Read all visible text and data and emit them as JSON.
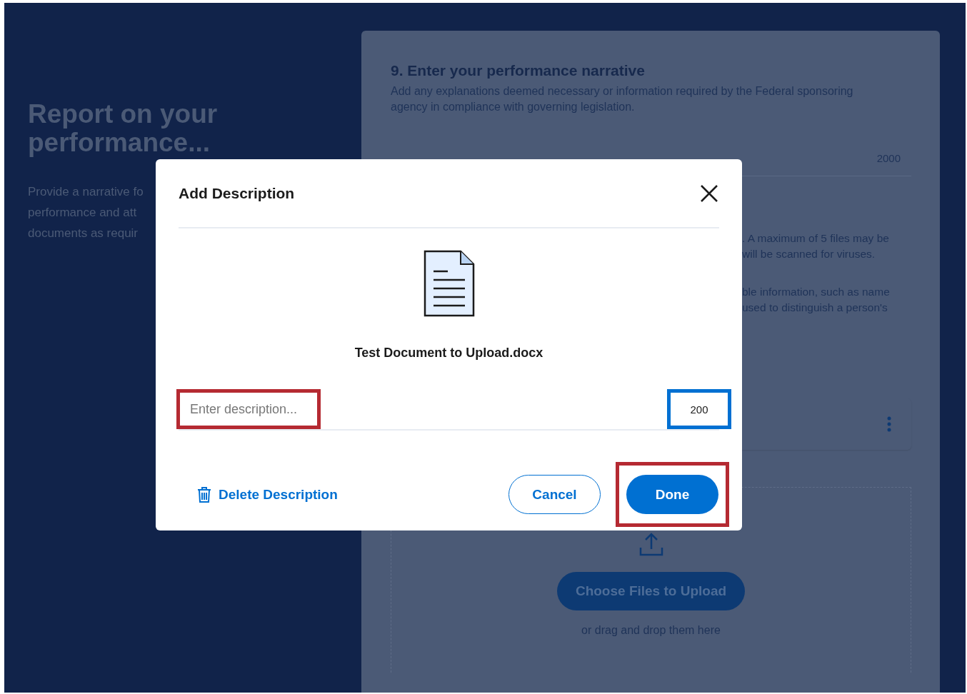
{
  "intro": {
    "title": "Report on your performance...",
    "lines": [
      "Provide a narrative fo",
      "performance and att",
      "documents as requir"
    ]
  },
  "panel": {
    "title": "9. Enter your performance narrative",
    "description": "Add any explanations deemed necessary or information required by the Federal sponsoring agency in compliance with governing legislation.",
    "char_limit": "2000",
    "notes": [
      {
        "lines": [
          ". A maximum of 5 files may be",
          "will be scanned for viruses."
        ]
      },
      {
        "lines": [
          "ble information, such as name",
          "used to distinguish a person's"
        ]
      }
    ],
    "upload_button": "Choose Files to Upload",
    "drop_hint": "or drag and drop them here"
  },
  "dialog": {
    "title": "Add Description",
    "file_name": "Test Document to Upload.docx",
    "description_field": {
      "placeholder": "Enter description...",
      "highlighted": true
    },
    "counter": {
      "text": "200",
      "highlighted": true
    },
    "delete_link": "Delete Description",
    "buttons": [
      {
        "kind": "secondary",
        "label": "Cancel",
        "highlighted": false
      },
      {
        "kind": "primary",
        "label": "Done",
        "highlighted": true
      }
    ]
  }
}
